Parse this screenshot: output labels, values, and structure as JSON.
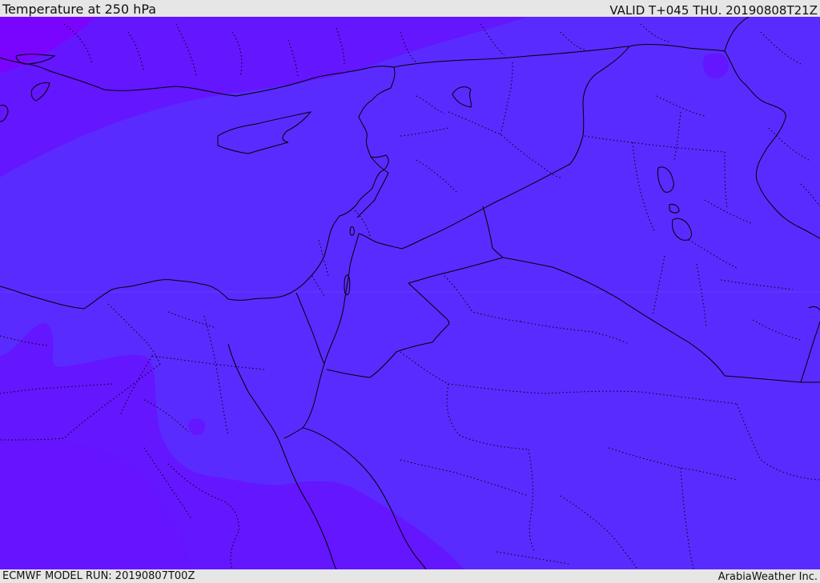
{
  "header": {
    "title": "Temperature at 250 hPa",
    "valid": "VALID T+045 THU. 20190808T21Z"
  },
  "footer": {
    "model_run": "ECMWF MODEL RUN: 20190807T00Z",
    "credit": "ArabiaWeather Inc."
  },
  "map": {
    "colors": {
      "warm_field": "#5a2bff",
      "mid_field": "#6416ff",
      "cool_field": "#7a05ff",
      "coast": "#000000",
      "border": "#000000"
    }
  }
}
